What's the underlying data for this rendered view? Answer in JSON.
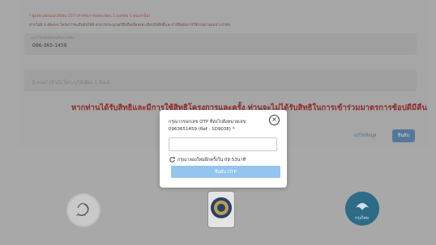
{
  "form": {
    "notice_line1": "* ผู้ลงทะเบียนและยืนยัน OTP (สำหรับการลงทะเบียน 1 เบอร์ต่อ 1 คนเท่านั้น)",
    "notice_line2": "หากไม่มี G-Wallet โครงการจะยืนยันได้ที่ สามารถระบุเบอร์มือถือเพื่อลงทะเบียนรับสิทธิ์และการยืนยันการใช้งานผ่านแอปฯ เป๋าตัง",
    "phone_label": "เบอร์โทรศัพท์มือถือที่ลงทะเบียน",
    "phone_value": "096-365-1459",
    "email_placeholder": "E-mail (ถ้ามี) ใส่ระบุได้เพียง 1 อีเมล์",
    "warning": "หากท่านได้รับสิทธิและมีการใช้สิทธิโครงการและครั้ง ท่านจะไม่ได้รับสิทธิในการเข้าร่วมมาตรการช้อปดีมีคืน",
    "retry_link": "แก้ไขข้อมูล",
    "confirm_button": "ยืนยัน"
  },
  "modal": {
    "line1": "กรุณากรอกเลข OTP ที่ส่งไปยังหมายเลข",
    "line2": "0963651459 (Ref : 1D9038)  *",
    "close_icon": "×",
    "otp_value": "",
    "resend_text": "กรุณาลองใหม่อีกครั้งใน 09:53นาที",
    "submit_button": "ยืนยัน OTP"
  },
  "logos": {
    "right_text": "กรุงไทย"
  },
  "colors": {
    "overlay": "#a8a8a8",
    "warning": "#8e2a2a",
    "confirm": "#57779a",
    "otp_button": "#94c4ef",
    "bank_blue": "#2d6b86"
  }
}
